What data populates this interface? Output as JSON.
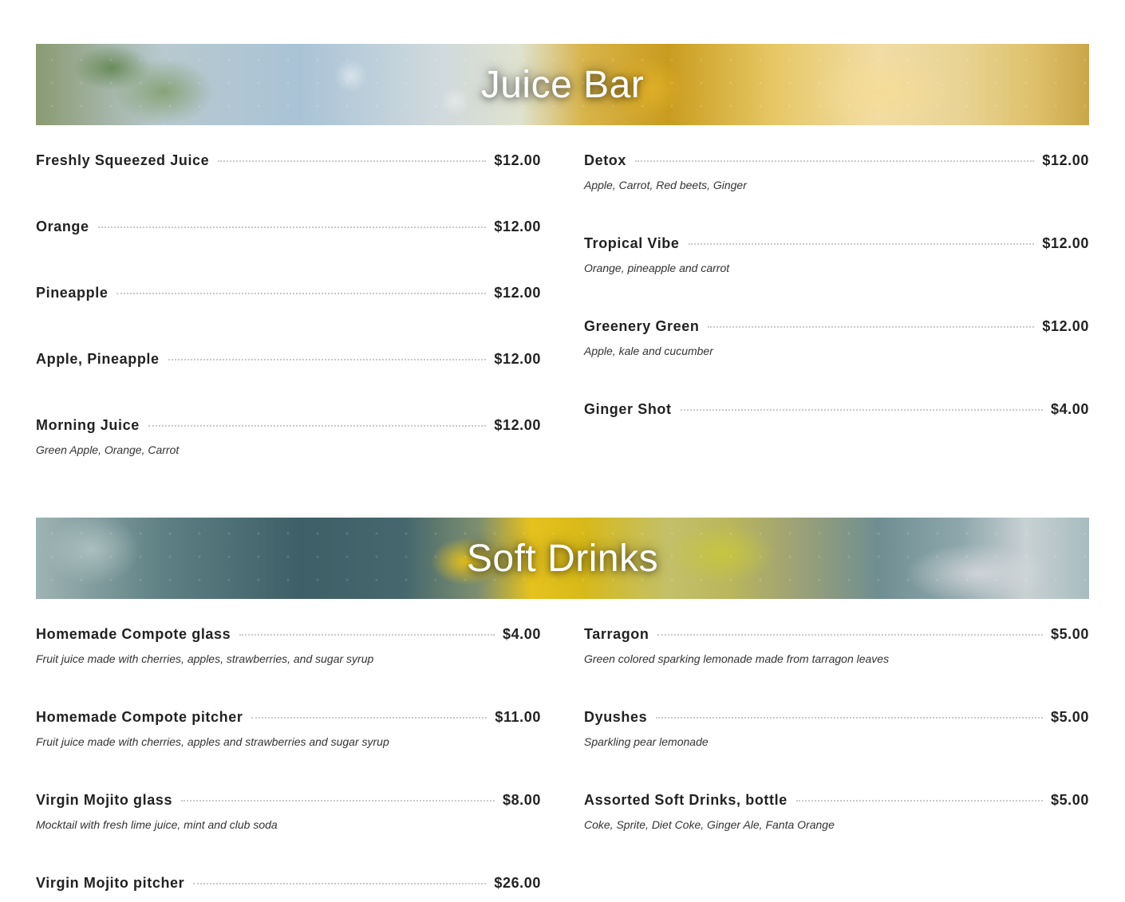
{
  "sections": [
    {
      "title": "Juice Bar",
      "left_items": [
        {
          "name": "Freshly Squeezed Juice",
          "price": "$12.00",
          "desc": ""
        },
        {
          "name": "Orange",
          "price": "$12.00",
          "desc": ""
        },
        {
          "name": "Pineapple",
          "price": "$12.00",
          "desc": ""
        },
        {
          "name": "Apple, Pineapple",
          "price": "$12.00",
          "desc": ""
        },
        {
          "name": "Morning Juice",
          "price": "$12.00",
          "desc": "Green Apple, Orange, Carrot"
        }
      ],
      "right_items": [
        {
          "name": "Detox",
          "price": "$12.00",
          "desc": "Apple, Carrot, Red beets, Ginger"
        },
        {
          "name": "Tropical Vibe",
          "price": "$12.00",
          "desc": "Orange, pineapple and carrot"
        },
        {
          "name": "Greenery Green",
          "price": "$12.00",
          "desc": "Apple, kale and cucumber"
        },
        {
          "name": "Ginger Shot",
          "price": "$4.00",
          "desc": ""
        }
      ]
    },
    {
      "title": "Soft Drinks",
      "left_items": [
        {
          "name": "Homemade Compote glass",
          "price": "$4.00",
          "desc": "Fruit juice made with cherries, apples, strawberries, and sugar syrup"
        },
        {
          "name": "Homemade Compote pitcher",
          "price": "$11.00",
          "desc": "Fruit juice made with cherries, apples and strawberries and sugar syrup"
        },
        {
          "name": "Virgin Mojito glass",
          "price": "$8.00",
          "desc": "Mocktail with fresh lime juice, mint and club soda"
        },
        {
          "name": "Virgin Mojito pitcher",
          "price": "$26.00",
          "desc": ""
        }
      ],
      "right_items": [
        {
          "name": "Tarragon",
          "price": "$5.00",
          "desc": "Green colored sparking lemonade made from tarragon leaves"
        },
        {
          "name": "Dyushes",
          "price": "$5.00",
          "desc": "Sparkling pear lemonade"
        },
        {
          "name": "Assorted Soft Drinks, bottle",
          "price": "$5.00",
          "desc": "Coke, Sprite, Diet Coke, Ginger Ale, Fanta Orange"
        }
      ]
    }
  ]
}
